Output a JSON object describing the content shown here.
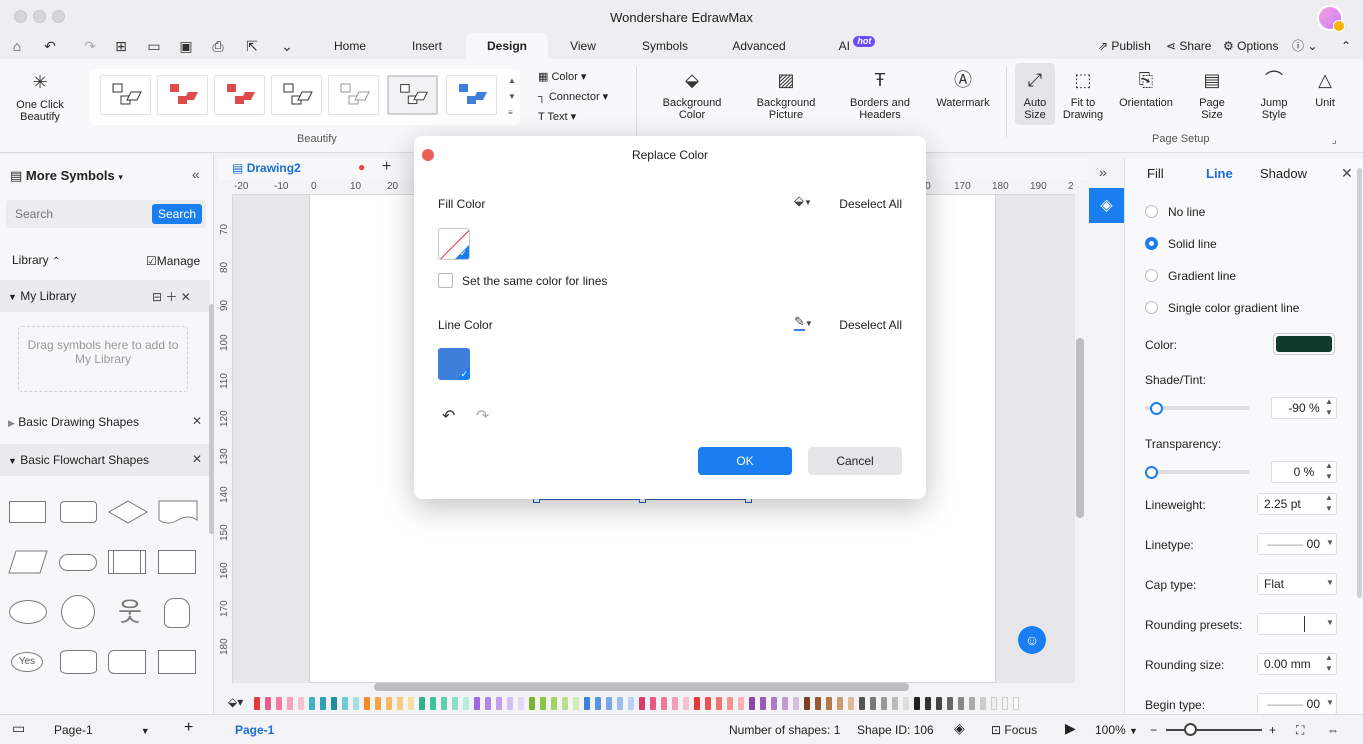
{
  "app": {
    "title": "Wondershare EdrawMax"
  },
  "menu": {
    "tabs": [
      "Home",
      "Insert",
      "Design",
      "View",
      "Symbols",
      "Advanced",
      "AI"
    ],
    "ai_badge": "hot",
    "publish": "Publish",
    "share": "Share",
    "options": "Options"
  },
  "ribbon": {
    "one_click_beautify": "One Click Beautify",
    "beautify_group": "Beautify",
    "color": "Color",
    "connector": "Connector",
    "text": "Text",
    "background_color": "Background Color",
    "background_picture": "Background Picture",
    "borders_headers": "Borders and Headers",
    "watermark": "Watermark",
    "auto_size": "Auto Size",
    "fit_to_drawing": "Fit to Drawing",
    "orientation": "Orientation",
    "page_size": "Page Size",
    "jump_style": "Jump Style",
    "unit": "Unit",
    "page_setup_group": "Page Setup"
  },
  "left_panel": {
    "title": "More Symbols",
    "search_placeholder": "Search",
    "search_button": "Search",
    "library": "Library",
    "manage": "Manage",
    "my_library": "My Library",
    "drag_hint": "Drag symbols here to add to My Library",
    "basic_drawing": "Basic Drawing Shapes",
    "basic_flowchart": "Basic Flowchart Shapes",
    "yes_shape": "Yes"
  },
  "document": {
    "tab": "Drawing2",
    "h_ticks": [
      "-20",
      "-10",
      "0",
      "10",
      "20",
      "160",
      "170",
      "180",
      "190",
      "2"
    ],
    "v_ticks": [
      "70",
      "80",
      "90",
      "100",
      "110",
      "120",
      "130",
      "140",
      "150",
      "160",
      "170",
      "180"
    ]
  },
  "dialog": {
    "title": "Replace Color",
    "fill_color": "Fill Color",
    "deselect_all_fill": "Deselect All",
    "same_color_lines": "Set the same color for lines",
    "line_color": "Line Color",
    "deselect_all_line": "Deselect All",
    "ok": "OK",
    "cancel": "Cancel",
    "line_swatch_color": "#3f7fdc"
  },
  "right_panel": {
    "tabs": {
      "fill": "Fill",
      "line": "Line",
      "shadow": "Shadow"
    },
    "no_line": "No line",
    "solid_line": "Solid line",
    "gradient_line": "Gradient line",
    "single_gradient": "Single color gradient line",
    "color_label": "Color:",
    "color_value": "#0e3b2a",
    "shade_label": "Shade/Tint:",
    "shade_value": "-90 %",
    "shade_level": 0.05,
    "transparency_label": "Transparency:",
    "transparency_value": "0 %",
    "transparency_level": 0,
    "lineweight_label": "Lineweight:",
    "lineweight_value": "2.25 pt",
    "linetype_label": "Linetype:",
    "linetype_value": "00",
    "cap_label": "Cap type:",
    "cap_value": "Flat",
    "rounding_presets_label": "Rounding presets:",
    "rounding_size_label": "Rounding size:",
    "rounding_size_value": "0.00 mm",
    "begin_type_label": "Begin type:",
    "begin_type_value": "00"
  },
  "status": {
    "page_select": "Page-1",
    "page_tab": "Page-1",
    "shapes": "Number of shapes: 1",
    "shape_id": "Shape ID: 106",
    "focus": "Focus",
    "zoom": "100%"
  }
}
